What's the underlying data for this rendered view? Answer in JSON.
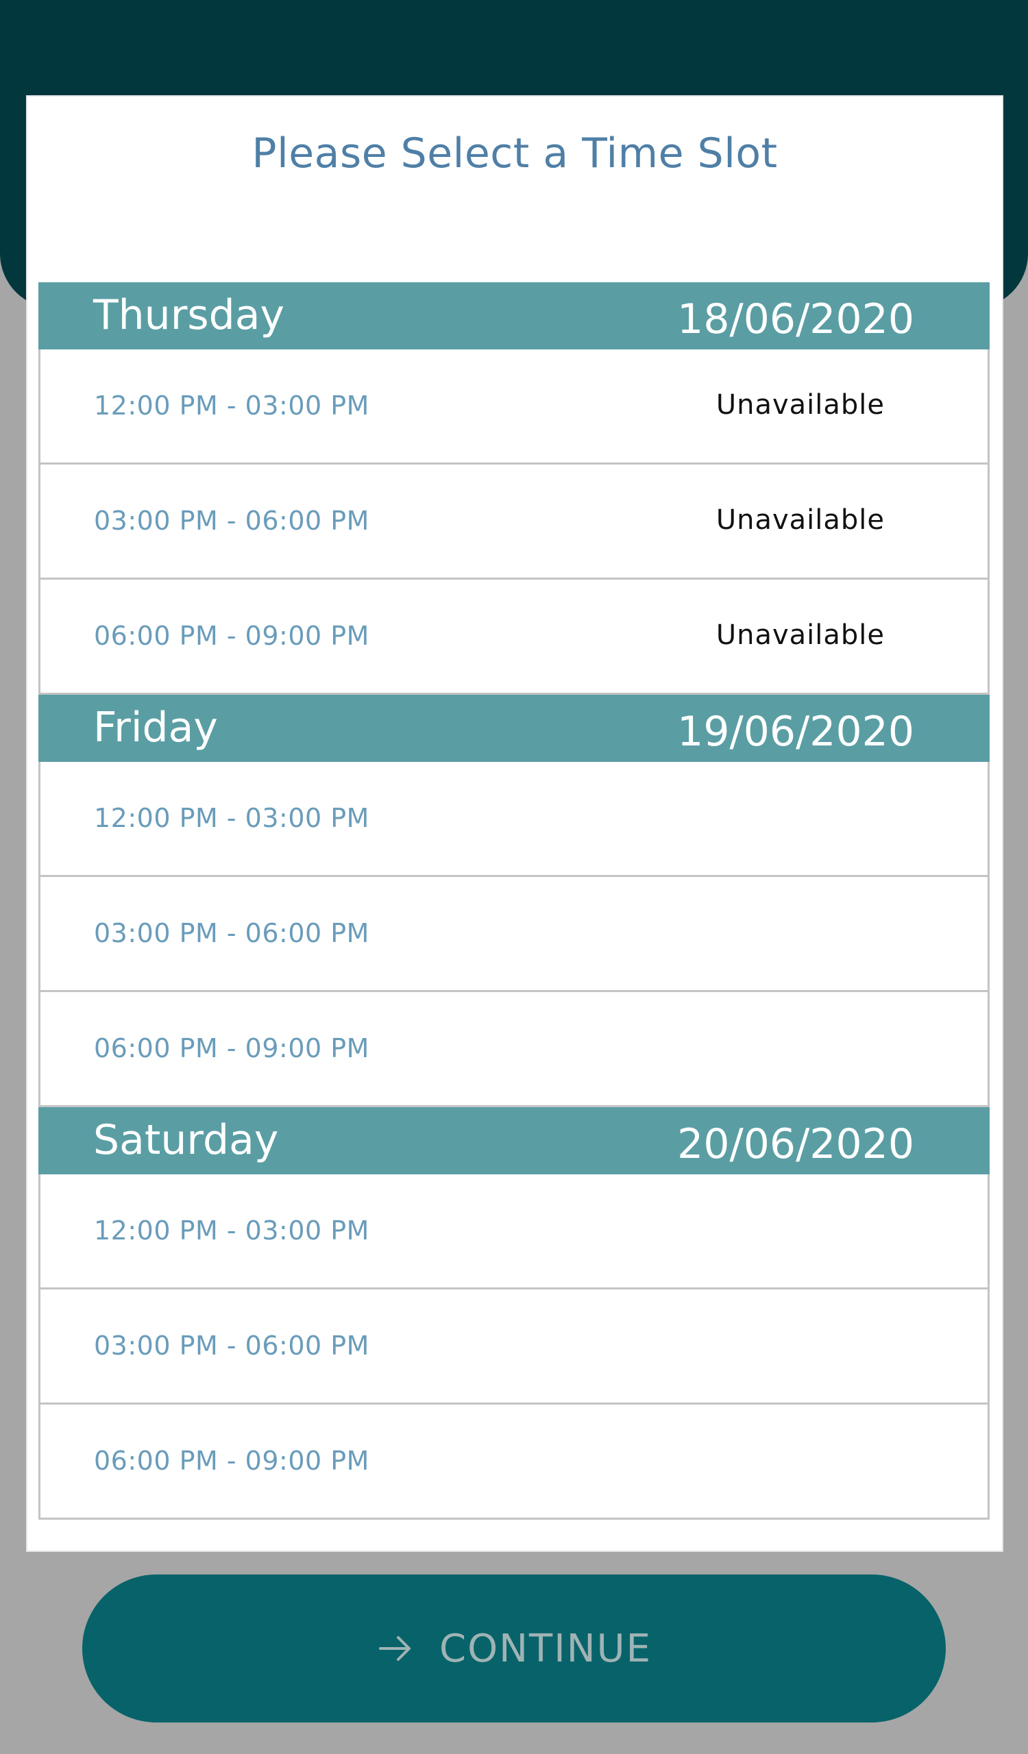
{
  "dialog": {
    "title": "Please Select a Time Slot"
  },
  "days": [
    {
      "name": "Thursday",
      "date": "18/06/2020",
      "slots": [
        {
          "time": "12:00 PM - 03:00 PM",
          "status": "Unavailable"
        },
        {
          "time": "03:00 PM - 06:00 PM",
          "status": "Unavailable"
        },
        {
          "time": "06:00 PM - 09:00 PM",
          "status": "Unavailable"
        }
      ]
    },
    {
      "name": "Friday",
      "date": "19/06/2020",
      "slots": [
        {
          "time": "12:00 PM - 03:00 PM",
          "status": ""
        },
        {
          "time": "03:00 PM - 06:00 PM",
          "status": ""
        },
        {
          "time": "06:00 PM - 09:00 PM",
          "status": ""
        }
      ]
    },
    {
      "name": "Saturday",
      "date": "20/06/2020",
      "slots": [
        {
          "time": "12:00 PM - 03:00 PM",
          "status": ""
        },
        {
          "time": "03:00 PM - 06:00 PM",
          "status": ""
        },
        {
          "time": "06:00 PM - 09:00 PM",
          "status": ""
        }
      ]
    }
  ],
  "footer": {
    "continue_label": "CONTINUE",
    "continue_icon": "arrow-right-icon"
  },
  "colors": {
    "banner": "#03373e",
    "day_header": "#5a9ea4",
    "button": "#076369",
    "title": "#4f7fa6",
    "slot_time": "#6a9cba"
  }
}
